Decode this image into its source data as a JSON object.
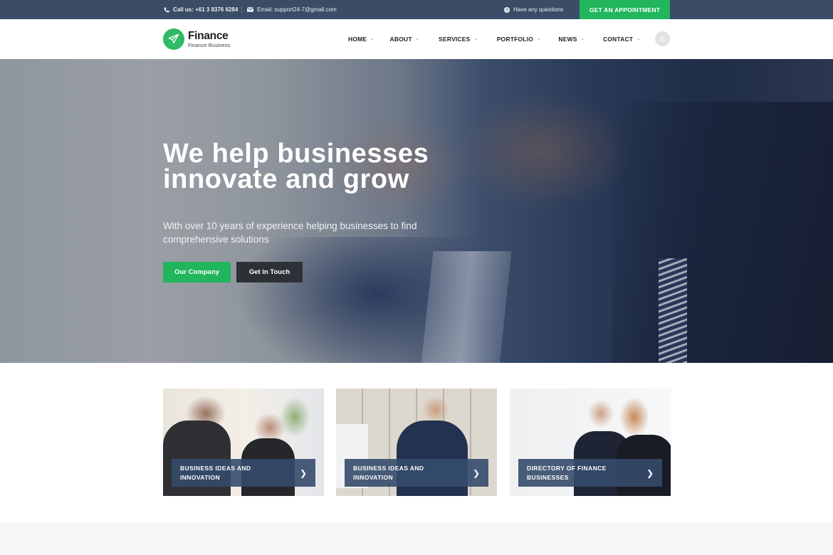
{
  "topbar": {
    "phone_label": "Call us: +61 3 8376 6284",
    "email_label": "Email: support24-7@gmail.com",
    "question_label": "Have any questions",
    "appointment_button": "GET AN APPOINTMENT",
    "icons": {
      "phone": "phone-icon",
      "email": "envelope-icon",
      "question": "question-circle-icon"
    }
  },
  "colors": {
    "topbar_bg": "#3b4d66",
    "accent_green": "#21b55c",
    "dark_button": "#2d3136",
    "card_overlay": "#354b6b",
    "bottom_band": "#f6f6f6"
  },
  "header": {
    "logo": {
      "title": "Finance",
      "subtitle": "Finance Business",
      "icon": "paper-plane-icon"
    },
    "nav": [
      {
        "label": "HOME"
      },
      {
        "label": "ABOUT"
      },
      {
        "label": "SERVICES"
      },
      {
        "label": "PORTFOLIO"
      },
      {
        "label": "NEWS"
      },
      {
        "label": "CONTACT"
      }
    ],
    "search_icon": "search-icon"
  },
  "hero": {
    "title": "We help businesses innovate and grow",
    "subtitle": "With over 10 years of experience helping businesses to find comprehensive solutions",
    "buttons": {
      "primary": "Our Company",
      "secondary": "Get in Touch"
    }
  },
  "cards": [
    {
      "title": "BUSINESS IDEAS AND INNOVATION"
    },
    {
      "title": "BUSINESS IDEAS AND INNOVATION"
    },
    {
      "title": "DIRECTORY OF FINANCE BUSINESSES"
    }
  ]
}
